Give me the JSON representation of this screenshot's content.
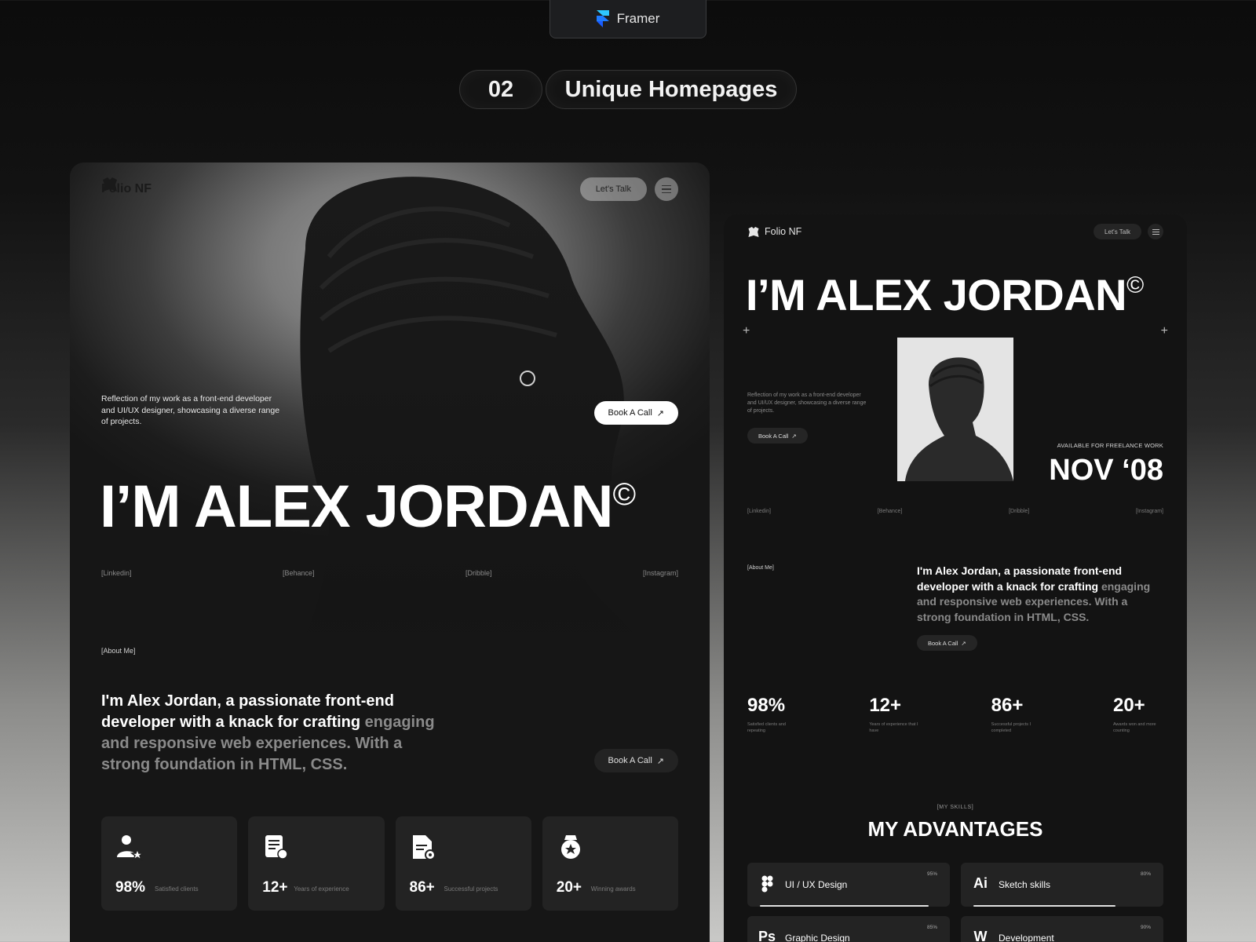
{
  "top_pill": {
    "label": "Framer"
  },
  "section": {
    "number": "02",
    "title": "Unique Homepages"
  },
  "left": {
    "brand": "Folio NF",
    "talk_label": "Let's Talk",
    "hero_desc": "Reflection of my work as a front-end developer and UI/UX designer, showcasing a diverse range of projects.",
    "book_label": "Book A Call",
    "name": "I’M ALEX JORDAN",
    "copyright": "©",
    "socials": [
      "[Linkedin]",
      "[Behance]",
      "[Dribble]",
      "[Instagram]"
    ],
    "about_tag": "[About Me]",
    "about_bright": "I'm Alex Jordan, a passionate front-end developer with a knack for crafting",
    "about_dim": " engaging and responsive web experiences. With a strong foundation in HTML, CSS.",
    "book_label2": "Book A Call",
    "stats": [
      {
        "value": "98%",
        "label": "Satisfied clients",
        "icon": "user-star-icon"
      },
      {
        "value": "12+",
        "label": "Years of experience",
        "icon": "certificate-icon"
      },
      {
        "value": "86+",
        "label": "Successful projects",
        "icon": "document-gear-icon"
      },
      {
        "value": "20+",
        "label": "Winning awards",
        "icon": "award-icon"
      }
    ]
  },
  "right": {
    "brand": "Folio NF",
    "talk_label": "Let's Talk",
    "name": "I’M ALEX JORDAN",
    "copyright": "©",
    "desc": "Reflection of my work as a front-end developer and UI/UX designer, showcasing a diverse range of projects.",
    "book_label": "Book A Call",
    "freelance": "AVAILABLE FOR FREELANCE WORK",
    "date": "NOV ‘08",
    "socials": [
      "[Linkedin]",
      "[Behance]",
      "[Dribble]",
      "[Instagram]"
    ],
    "about_tag": "[About Me]",
    "about_bright": "I'm Alex Jordan, a passionate front-end developer with a knack for crafting",
    "about_dim": " engaging and responsive web experiences. With a strong foundation in HTML, CSS.",
    "book_label2": "Book A Call",
    "stats": [
      {
        "value": "98%",
        "label": "Satisfied clients and repeating"
      },
      {
        "value": "12+",
        "label": "Years of experience that I have"
      },
      {
        "value": "86+",
        "label": "Successful projects I completed"
      },
      {
        "value": "20+",
        "label": "Awards won and more counting"
      }
    ],
    "skills_tag": "[MY SKILLS]",
    "advantages_title": "MY ADVANTAGES",
    "skills": [
      {
        "name": "UI / UX Design",
        "percent": "95%",
        "fill": 0.95,
        "icon": "figma-icon",
        "glyph": ""
      },
      {
        "name": "Sketch skills",
        "percent": "80%",
        "fill": 0.8,
        "icon": "illustrator-icon",
        "glyph": "Ai"
      },
      {
        "name": "Graphic Design",
        "percent": "85%",
        "fill": 0.85,
        "icon": "photoshop-icon",
        "glyph": "Ps"
      },
      {
        "name": "Development",
        "percent": "90%",
        "fill": 0.9,
        "icon": "webflow-icon",
        "glyph": "W"
      }
    ]
  }
}
